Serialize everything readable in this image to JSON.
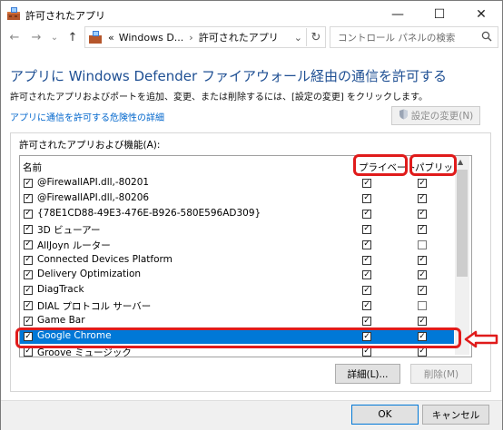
{
  "window": {
    "title": "許可されたアプリ",
    "controls": {
      "minimize": "—",
      "maximize": "☐",
      "close": "✕"
    }
  },
  "nav": {
    "back": "←",
    "forward": "→",
    "history": "⌄",
    "up": "↑",
    "address_prefix": "«",
    "crumbs": [
      "Windows D...",
      "許可されたアプリ"
    ],
    "crumb_sep": "›",
    "dropdown": "⌄",
    "refresh": "↻",
    "search_placeholder": "コントロール パネルの検索",
    "search_icon": "search-icon"
  },
  "page": {
    "title": "アプリに Windows Defender ファイアウォール経由の通信を許可する",
    "description": "許可されたアプリおよびポートを追加、変更、または削除するには、[設定の変更] をクリックします。",
    "risk_link": "アプリに通信を許可する危険性の詳細",
    "change_settings_button": "設定の変更(N)"
  },
  "apps_group": {
    "label": "許可されたアプリおよび機能(A):",
    "columns": {
      "name": "名前",
      "private": "プライベート",
      "public": "パブリック"
    },
    "rows": [
      {
        "name": "@FirewallAPI.dll,-80201",
        "enabled": true,
        "private": true,
        "public": true,
        "selected": false
      },
      {
        "name": "@FirewallAPI.dll,-80206",
        "enabled": true,
        "private": true,
        "public": true,
        "selected": false
      },
      {
        "name": "{78E1CD88-49E3-476E-B926-580E596AD309}",
        "enabled": true,
        "private": true,
        "public": true,
        "selected": false
      },
      {
        "name": "3D ビューアー",
        "enabled": true,
        "private": true,
        "public": true,
        "selected": false
      },
      {
        "name": "AllJoyn ルーター",
        "enabled": true,
        "private": true,
        "public": false,
        "selected": false
      },
      {
        "name": "Connected Devices Platform",
        "enabled": true,
        "private": true,
        "public": true,
        "selected": false
      },
      {
        "name": "Delivery Optimization",
        "enabled": true,
        "private": true,
        "public": true,
        "selected": false
      },
      {
        "name": "DiagTrack",
        "enabled": true,
        "private": true,
        "public": true,
        "selected": false
      },
      {
        "name": "DIAL プロトコル サーバー",
        "enabled": true,
        "private": true,
        "public": false,
        "selected": false
      },
      {
        "name": "Game Bar",
        "enabled": true,
        "private": true,
        "public": true,
        "selected": false
      },
      {
        "name": "Google Chrome",
        "enabled": true,
        "private": true,
        "public": true,
        "selected": true
      },
      {
        "name": "Groove ミュージック",
        "enabled": true,
        "private": true,
        "public": true,
        "selected": false
      }
    ],
    "details_button": "詳細(L)...",
    "remove_button": "削除(M)"
  },
  "footer": {
    "ok_button": "OK",
    "cancel_button": "キャンセル"
  },
  "colors": {
    "title_blue": "#1e4f93",
    "link_blue": "#0066cc",
    "selection_blue": "#0078d7",
    "annotation_red": "#e01b1b"
  }
}
